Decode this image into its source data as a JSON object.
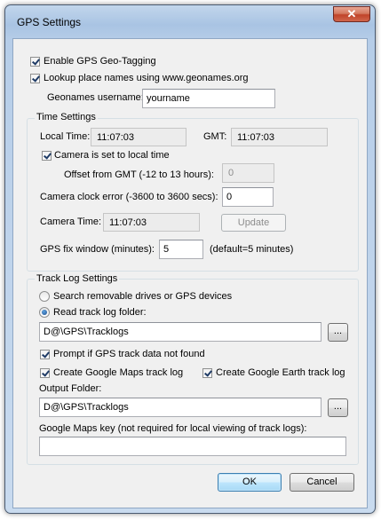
{
  "window": {
    "title": "GPS Settings",
    "close_glyph": "✕"
  },
  "geotag": {
    "enable_label": "Enable GPS Geo-Tagging",
    "lookup_label": "Lookup place names using www.geonames.org",
    "username_label": "Geonames username:",
    "username_value": "yourname"
  },
  "time_settings": {
    "group_label": "Time Settings",
    "local_time_label": "Local Time:",
    "local_time_value": "11:07:03",
    "gmt_label": "GMT:",
    "gmt_value": "11:07:03",
    "camera_local_label": "Camera is set to local time",
    "offset_label": "Offset from GMT (-12 to 13 hours):",
    "offset_value": "0",
    "clock_error_label": "Camera clock error (-3600 to 3600 secs):",
    "clock_error_value": "0",
    "camera_time_label": "Camera Time:",
    "camera_time_value": "11:07:03",
    "update_label": "Update",
    "fix_window_label": "GPS fix window (minutes):",
    "fix_window_value": "5",
    "fix_window_hint": "(default=5 minutes)"
  },
  "track_log": {
    "group_label": "Track Log Settings",
    "search_label": "Search removable drives or GPS devices",
    "read_folder_label": "Read track log folder:",
    "folder_value": "D@\\GPS\\Tracklogs",
    "browse_label": "...",
    "prompt_label": "Prompt if GPS track data not found",
    "google_maps_label": "Create Google Maps track log",
    "google_earth_label": "Create Google Earth track log",
    "output_folder_label": "Output Folder:",
    "output_folder_value": "D@\\GPS\\Tracklogs",
    "output_browse_label": "...",
    "maps_key_label": "Google Maps key (not required for local viewing of track logs):",
    "maps_key_value": ""
  },
  "footer": {
    "ok_label": "OK",
    "cancel_label": "Cancel"
  }
}
